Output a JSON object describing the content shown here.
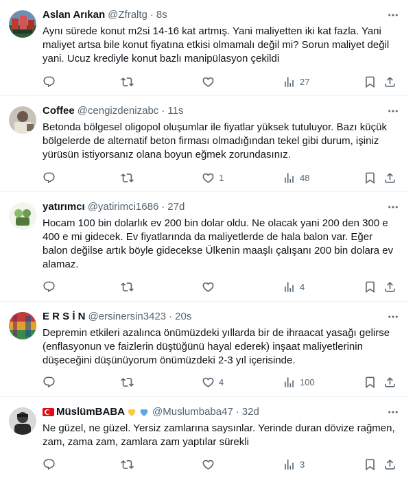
{
  "tweets": [
    {
      "name": "Aslan Arıkan",
      "handle": "@Zfraltg",
      "time": "8s",
      "text": "Aynı sürede konut m2si 14-16 kat artmış. Yani maliyetten  iki kat fazla. Yani maliyet artsa bile konut fiyatına etkisi olmamalı değil mi? Sorun maliyet değil yani. Ucuz krediyle konut bazlı manipülasyon çekildi",
      "replies": "",
      "retweets": "",
      "likes": "",
      "views": "27"
    },
    {
      "name": "Coffee",
      "handle": "@cengizdenizabc",
      "time": "11s",
      "text": "Betonda bölgesel oligopol oluşumlar ile fiyatlar yüksek tutuluyor. Bazı küçük bölgelerde de alternatif beton firması olmadığından tekel gibi durum, işiniz yürüsün istiyorsanız olana boyun eğmek zorundasınız.",
      "replies": "",
      "retweets": "",
      "likes": "1",
      "views": "48"
    },
    {
      "name": "yatırımcı",
      "handle": "@yatirimci1686",
      "time": "27d",
      "text": "Hocam 100 bin dolarlık ev 200 bin dolar oldu. Ne olacak yani 200 den 300 e 400 e mi gidecek. Ev fiyatlarında da maliyetlerde de hala balon var. Eğer balon değilse artık böyle gidecekse  Ülkenin maaşlı çalışanı 200 bin dolara ev alamaz.",
      "replies": "",
      "retweets": "",
      "likes": "",
      "views": "4"
    },
    {
      "name": "E R S İ N",
      "handle": "@ersinersin3423",
      "time": "20s",
      "text": "Depremin etkileri azalınca önümüzdeki yıllarda bir de ihraacat yasağı gelirse (enflasyonun ve faizlerin düştüğünü hayal ederek) inşaat maliyetlerinin düşeceğini düşünüyorum önümüzdeki 2-3 yıl içerisinde.",
      "replies": "",
      "retweets": "",
      "likes": "4",
      "views": "100"
    },
    {
      "name": "MüslümBABA",
      "handle": "@Muslumbaba47",
      "time": "32d",
      "text": "Ne güzel, ne güzel. Yersiz zamlarına saysınlar. Yerinde duran dövize rağmen, zam, zama zam, zamlara zam yaptılar sürekli",
      "replies": "",
      "retweets": "",
      "likes": "",
      "views": "3"
    }
  ],
  "icons": {
    "more": "more-icon",
    "reply": "reply-icon",
    "retweet": "retweet-icon",
    "like": "like-icon",
    "views": "views-icon",
    "bookmark": "bookmark-icon",
    "share": "share-icon"
  },
  "colors": {
    "text": "#0f1419",
    "secondary": "#536471",
    "divider": "#eff3f4",
    "heart_yellow": "#f7c948",
    "heart_blue": "#5aa9e6",
    "flag_red": "#e30a17"
  }
}
